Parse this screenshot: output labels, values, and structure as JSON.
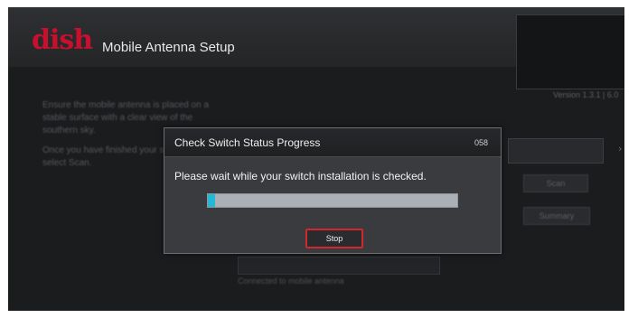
{
  "header": {
    "logo_text": "dish",
    "app_title": "Mobile Antenna Setup"
  },
  "background": {
    "version_text": "Version 1.3.1 | 6.0",
    "instructions": [
      "Ensure the mobile antenna is placed on a stable surface with a clear view of the southern sky.",
      "Once you have finished your selections, select Scan."
    ],
    "field_value": "",
    "buttons": {
      "scan": "Scan",
      "summary": "Summary"
    },
    "caption": "Connected to mobile antenna"
  },
  "dialog": {
    "title": "Check Switch Status Progress",
    "code": "058",
    "message": "Please wait while your switch installation is checked.",
    "progress_fraction": 0.03,
    "stop_label": "Stop"
  },
  "colors": {
    "brand_red": "#c8102e",
    "progress_fill": "#22b8d6",
    "button_highlight": "#d2272e"
  }
}
